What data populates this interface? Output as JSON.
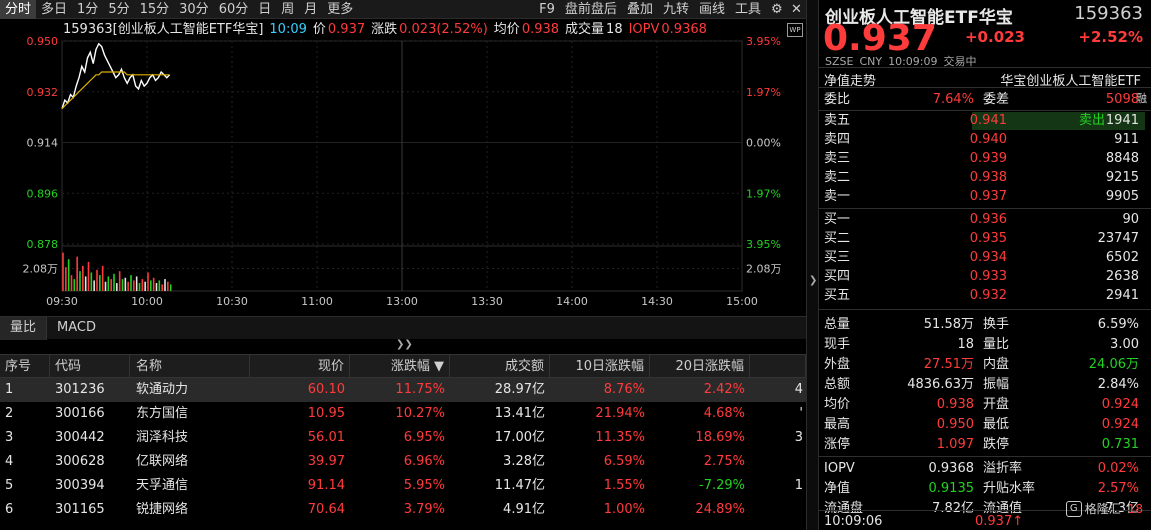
{
  "toolbar": {
    "left": [
      "分时",
      "多日",
      "1分",
      "5分",
      "15分",
      "30分",
      "60分",
      "日",
      "周",
      "月",
      "更多"
    ],
    "right": [
      "F9",
      "盘前盘后",
      "叠加",
      "九转",
      "画线",
      "工具"
    ],
    "icons": [
      "gear-icon",
      "close-icon"
    ]
  },
  "chart_info": {
    "name": "159363[创业板人工智能ETF华宝]",
    "time": "10:09",
    "price_label": "价",
    "price": "0.937",
    "chg_label": "涨跌",
    "chg": "0.023(2.52%)",
    "avg_label": "均价",
    "avg": "0.938",
    "vol_label": "成交量",
    "vol": "18",
    "iopv_label": "IOPV",
    "iopv": "0.9368",
    "badge": "WP"
  },
  "chart_data": {
    "type": "line",
    "title": "",
    "prev_close": 0.914,
    "y_left_ticks": [
      "0.950",
      "0.932",
      "0.914",
      "0.896",
      "0.878"
    ],
    "y_right_ticks": [
      "3.95%",
      "1.97%",
      "0.00%",
      "1.97%",
      "3.95%"
    ],
    "vol_tick": "2.08万",
    "x_ticks": [
      "09:30",
      "10:00",
      "10:30",
      "11:00",
      "13:00",
      "13:30",
      "14:00",
      "14:30",
      "15:00"
    ],
    "ylim": [
      0.878,
      0.95
    ],
    "series": [
      {
        "name": "",
        "color": "#ffffff",
        "values": [
          0.926,
          0.929,
          0.928,
          0.931,
          0.93,
          0.934,
          0.937,
          0.941,
          0.939,
          0.944,
          0.946,
          0.942,
          0.947,
          0.949,
          0.948,
          0.945,
          0.943,
          0.941,
          0.939,
          0.937,
          0.938,
          0.94,
          0.937,
          0.935,
          0.937,
          0.938,
          0.934,
          0.933,
          0.936,
          0.934,
          0.935,
          0.937,
          0.938,
          0.936,
          0.937,
          0.939,
          0.938,
          0.937,
          0.938
        ]
      },
      {
        "name": "",
        "color": "#e0b000",
        "values": [
          0.926,
          0.927,
          0.928,
          0.929,
          0.93,
          0.931,
          0.932,
          0.933,
          0.934,
          0.935,
          0.936,
          0.937,
          0.938,
          0.938,
          0.939,
          0.939,
          0.939,
          0.939,
          0.939,
          0.939,
          0.939,
          0.939,
          0.939,
          0.938,
          0.938,
          0.938,
          0.938,
          0.938,
          0.938,
          0.938,
          0.938,
          0.938,
          0.938,
          0.938,
          0.938,
          0.938,
          0.938,
          0.938,
          0.938
        ]
      }
    ],
    "volumes": [
      2.9,
      1.8,
      2.4,
      1.2,
      0.9,
      2.6,
      1.5,
      1.9,
      1.1,
      2.2,
      1.4,
      0.8,
      1.6,
      1.2,
      1.9,
      0.7,
      1.1,
      0.9,
      1.3,
      0.6,
      1.5,
      0.9,
      1.0,
      0.7,
      1.2,
      0.8,
      1.1,
      0.6,
      0.9,
      0.7,
      1.4,
      0.8,
      1.0,
      0.6,
      0.8,
      0.5,
      0.9,
      0.7,
      0.5
    ],
    "volume_colors": [
      "r",
      "r",
      "g",
      "r",
      "g",
      "r",
      "g",
      "r",
      "w",
      "r",
      "g",
      "w",
      "r",
      "g",
      "r",
      "w",
      "g",
      "r",
      "g",
      "w",
      "r",
      "g",
      "w",
      "r",
      "g",
      "r",
      "w",
      "g",
      "r",
      "w",
      "r",
      "g",
      "r",
      "w",
      "g",
      "r",
      "w",
      "r",
      "g"
    ],
    "vol_max": 3.4,
    "grid": true
  },
  "sub_tabs": [
    "量比",
    "MACD"
  ],
  "table": {
    "headers": [
      "序号",
      "代码",
      "名称",
      "现价",
      "涨跌幅 ▼",
      "成交额",
      "10日涨跌幅",
      "20日涨跌幅",
      ""
    ],
    "rows": [
      {
        "no": "1",
        "code": "301236",
        "name": "软通动力",
        "price": "60.10",
        "pct": "11.75%",
        "vol": "28.97亿",
        "p10": "8.76%",
        "p20": "2.42%",
        "x": "4",
        "c10": "r",
        "c20": "r"
      },
      {
        "no": "2",
        "code": "300166",
        "name": "东方国信",
        "price": "10.95",
        "pct": "10.27%",
        "vol": "13.41亿",
        "p10": "21.94%",
        "p20": "4.68%",
        "x": "'",
        "c10": "r",
        "c20": "r"
      },
      {
        "no": "3",
        "code": "300442",
        "name": "润泽科技",
        "price": "56.01",
        "pct": "6.95%",
        "vol": "17.00亿",
        "p10": "11.35%",
        "p20": "18.69%",
        "x": "3",
        "c10": "r",
        "c20": "r"
      },
      {
        "no": "4",
        "code": "300628",
        "name": "亿联网络",
        "price": "39.97",
        "pct": "6.96%",
        "vol": "3.28亿",
        "p10": "6.59%",
        "p20": "2.75%",
        "x": "",
        "c10": "r",
        "c20": "r"
      },
      {
        "no": "5",
        "code": "300394",
        "name": "天孚通信",
        "price": "91.14",
        "pct": "5.95%",
        "vol": "11.47亿",
        "p10": "1.55%",
        "p20": "-7.29%",
        "x": "1",
        "c10": "r",
        "c20": "g"
      },
      {
        "no": "6",
        "code": "301165",
        "name": "锐捷网络",
        "price": "70.64",
        "pct": "3.79%",
        "vol": "4.91亿",
        "p10": "1.00%",
        "p20": "24.89%",
        "x": "",
        "c10": "r",
        "c20": "r"
      }
    ]
  },
  "quote": {
    "title": "创业板人工智能ETF华宝",
    "code": "159363",
    "price": "0.937",
    "chg": "+0.023",
    "chg_pct": "+2.52%",
    "meta": [
      "SZSE",
      "CNY",
      "10:09:09",
      "交易中"
    ],
    "nav_label": "净值走势",
    "fund_name": "华宝创业板人工智能ETF",
    "rong": "融",
    "wei_bi_label": "委比",
    "wei_bi": "7.64%",
    "wei_cha_label": "委差",
    "wei_cha": "5098",
    "asks": [
      {
        "label": "卖五",
        "price": "0.941",
        "vol": "1941",
        "tag": "卖出"
      },
      {
        "label": "卖四",
        "price": "0.940",
        "vol": "911",
        "tag": ""
      },
      {
        "label": "卖三",
        "price": "0.939",
        "vol": "8848",
        "tag": ""
      },
      {
        "label": "卖二",
        "price": "0.938",
        "vol": "9215",
        "tag": ""
      },
      {
        "label": "卖一",
        "price": "0.937",
        "vol": "9905",
        "tag": ""
      }
    ],
    "bids": [
      {
        "label": "买一",
        "price": "0.936",
        "vol": "90"
      },
      {
        "label": "买二",
        "price": "0.935",
        "vol": "23747"
      },
      {
        "label": "买三",
        "price": "0.934",
        "vol": "6502"
      },
      {
        "label": "买四",
        "price": "0.933",
        "vol": "2638"
      },
      {
        "label": "买五",
        "price": "0.932",
        "vol": "2941"
      }
    ],
    "stats": [
      {
        "a": "总量",
        "b": "51.58万",
        "bc": "white",
        "c": "换手",
        "d": "6.59%",
        "dc": "white"
      },
      {
        "a": "现手",
        "b": "18",
        "bc": "white",
        "c": "量比",
        "d": "3.00",
        "dc": "white"
      },
      {
        "a": "外盘",
        "b": "27.51万",
        "bc": "red",
        "c": "内盘",
        "d": "24.06万",
        "dc": "green"
      },
      {
        "a": "总额",
        "b": "4836.63万",
        "bc": "white",
        "c": "振幅",
        "d": "2.84%",
        "dc": "white"
      },
      {
        "a": "均价",
        "b": "0.938",
        "bc": "red",
        "c": "开盘",
        "d": "0.924",
        "dc": "red"
      },
      {
        "a": "最高",
        "b": "0.950",
        "bc": "red",
        "c": "最低",
        "d": "0.924",
        "dc": "red"
      },
      {
        "a": "涨停",
        "b": "1.097",
        "bc": "red",
        "c": "跌停",
        "d": "0.731",
        "dc": "green"
      }
    ],
    "stats2": [
      {
        "a": "IOPV",
        "b": "0.9368",
        "bc": "white",
        "c": "溢折率",
        "d": "0.02%",
        "dc": "red"
      },
      {
        "a": "净值",
        "b": "0.9135",
        "bc": "green",
        "c": "升贴水率",
        "d": "2.57%",
        "dc": "red"
      },
      {
        "a": "流通盘",
        "b": "7.82亿",
        "bc": "white",
        "c": "流通值",
        "d": "7.3亿",
        "dc": "white"
      }
    ],
    "last_time": "10:09:06",
    "last_price": "0.937↑",
    "last_vol": "18",
    "logo_text": "格隆汇",
    "logo_mark": "G"
  }
}
